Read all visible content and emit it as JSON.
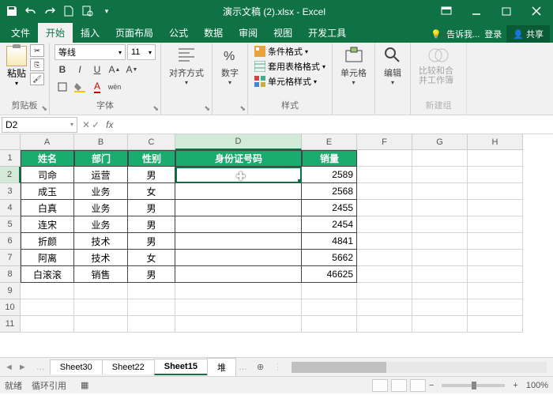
{
  "title": "演示文稿 (2).xlsx - Excel",
  "tabs": {
    "file": "文件",
    "home": "开始",
    "insert": "插入",
    "layout": "页面布局",
    "formula": "公式",
    "data": "数据",
    "review": "审阅",
    "view": "视图",
    "dev": "开发工具",
    "tell": "告诉我...",
    "login": "登录",
    "share": "共享"
  },
  "ribbon": {
    "clipboard": {
      "label": "剪贴板",
      "paste": "粘贴"
    },
    "font": {
      "label": "字体",
      "name": "等线",
      "size": "11"
    },
    "align": {
      "label": "对齐方式"
    },
    "number": {
      "label": "数字"
    },
    "styles": {
      "label": "样式",
      "cond": "条件格式",
      "table": "套用表格格式",
      "cell": "单元格样式"
    },
    "cells": {
      "label": "单元格"
    },
    "editing": {
      "label": "编辑"
    },
    "newgroup": {
      "label": "新建组",
      "compare": "比较和合并工作簿"
    }
  },
  "namebox": "D2",
  "columns": [
    "A",
    "B",
    "C",
    "D",
    "E",
    "F",
    "G",
    "H"
  ],
  "headers": {
    "a": "姓名",
    "b": "部门",
    "c": "性别",
    "d": "身份证号码",
    "e": "销量"
  },
  "rows": [
    {
      "a": "司命",
      "b": "运营",
      "c": "男",
      "d": "",
      "e": "2589"
    },
    {
      "a": "成玉",
      "b": "业务",
      "c": "女",
      "d": "",
      "e": "2568"
    },
    {
      "a": "白真",
      "b": "业务",
      "c": "男",
      "d": "",
      "e": "2455"
    },
    {
      "a": "连宋",
      "b": "业务",
      "c": "男",
      "d": "",
      "e": "2454"
    },
    {
      "a": "折颜",
      "b": "技术",
      "c": "男",
      "d": "",
      "e": "4841"
    },
    {
      "a": "阿离",
      "b": "技术",
      "c": "女",
      "d": "",
      "e": "5662"
    },
    {
      "a": "白滚滚",
      "b": "销售",
      "c": "男",
      "d": "",
      "e": "46625"
    }
  ],
  "sheets": {
    "s1": "Sheet30",
    "s2": "Sheet22",
    "s3": "Sheet15",
    "s4": "堆"
  },
  "status": {
    "ready": "就绪",
    "circ": "循环引用",
    "zoom": "100%"
  }
}
